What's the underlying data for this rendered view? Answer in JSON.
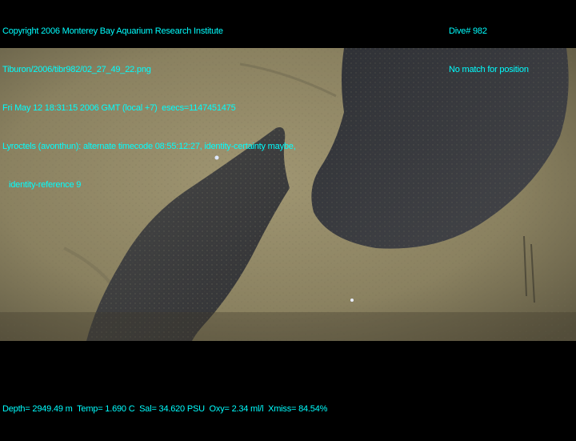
{
  "header_left": {
    "line1": "Copyright 2006 Monterey Bay Aquarium Research Institute",
    "line2": "Tiburon/2006/tibr982/02_27_49_22.png",
    "line3": "Fri May 12 18:31:15 2006 GMT (local +7)  esecs=1147451475",
    "line4": "Lyroctels (avonthun): alternate timecode 08:55:12:27, identity-certainty maybe,",
    "line5": "identity-reference 9"
  },
  "header_right": {
    "dive": "Dive# 982",
    "position": "No match for position"
  },
  "footer": {
    "telemetry": "Depth= 2949.49 m  Temp= 1.690 C  Sal= 34.620 PSU  Oxy= 2.34 ml/l  Xmiss= 84.54%"
  },
  "colors": {
    "overlay_text": "#00ffff",
    "sediment": "#8c8360",
    "rock": "#3a3a3c"
  }
}
